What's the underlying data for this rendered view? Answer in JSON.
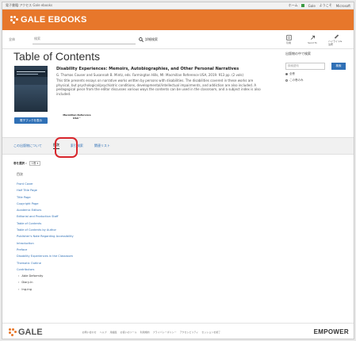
{
  "browser": {
    "tab": "電子書籍:アクセス Gale ebooks",
    "bookmarks": [
      "ホーム",
      "Gale",
      "ようこそ",
      "Microsoft"
    ]
  },
  "header": {
    "logo_text": "GALE EBOOKS",
    "brand_color": "#e7772b"
  },
  "search": {
    "select_label": "全体",
    "placeholder": "検索",
    "button_label": "詳細検索"
  },
  "toolbar": {
    "items": [
      {
        "label": "引用",
        "icon": "quote-icon"
      },
      {
        "label": "Send To",
        "icon": "send-icon"
      },
      {
        "label": "ハイライト&注釈",
        "icon": "pen-icon"
      }
    ]
  },
  "page": {
    "title": "Table of Contents"
  },
  "book": {
    "title": "Disability Experiences: Memoirs, Autobiographies, and Other Personal Narratives",
    "authors": "G. Thomas Couser and Susannah B. Mintz, eds. Farmington Hills, MI: Macmillan Reference USA, 2019. 913 pp. (2 vols)",
    "description": "This title presents essays on narrative works written by persons with disabilities. The disabilities covered in these works are physical, but psychological/psychiatric conditions, developmental/intellectual impairments, and addiction are also included. A pedagogical piece from the editor discusses various ways the contents can be used in the classroom, and a subject index is also included.",
    "ebook_button": "電子ブックを表示",
    "publisher_logo": "Macmillan Reference USA™"
  },
  "side_panel": {
    "title": "出版物の中で検索",
    "input_placeholder": "検索語句",
    "button_label": "検索",
    "options": [
      "全巻",
      "この巻のみ"
    ]
  },
  "tabs": [
    {
      "label": "この出版物について",
      "active": false
    },
    {
      "label": "目次",
      "active": true
    },
    {
      "label": "索引検索",
      "active": false
    },
    {
      "label": "関連リスト",
      "active": false
    }
  ],
  "chapter_select": {
    "label": "巻を選択 :",
    "value": "1巻 ▾"
  },
  "contents": {
    "heading": "目次",
    "items": [
      {
        "label": "Front Cover",
        "expandable": false
      },
      {
        "label": "Half Title Page",
        "expandable": false
      },
      {
        "label": "Title Page",
        "expandable": false
      },
      {
        "label": "Copyright Page",
        "expandable": false
      },
      {
        "label": "Academic Editors",
        "expandable": false
      },
      {
        "label": "Editorial and Production Staff",
        "expandable": false
      },
      {
        "label": "Table of Contents",
        "expandable": false
      },
      {
        "label": "Table of Contents by Author",
        "expandable": false
      },
      {
        "label": "Publisher's Note Regarding Accessibility",
        "expandable": false
      },
      {
        "label": "Introduction",
        "expandable": false
      },
      {
        "label": "Preface",
        "expandable": false
      },
      {
        "label": "Disability Experiences in the Classroom",
        "expandable": false
      },
      {
        "label": "Thematic Outline",
        "expandable": false
      },
      {
        "label": "Contributors",
        "expandable": false
      },
      {
        "label": "Able Deformity",
        "expandable": true
      },
      {
        "label": "Diary-In",
        "expandable": true
      },
      {
        "label": "Ing-ing",
        "expandable": true
      }
    ]
  },
  "footer": {
    "logo_text": "GALE",
    "links": [
      "お問い合わせ",
      "ヘルプ",
      "用語集",
      "お使いのツール",
      "利用規約",
      "プライバシーポリシー",
      "アクセシビリティ",
      "セッションを終了"
    ],
    "partner": "EMPOWER"
  }
}
